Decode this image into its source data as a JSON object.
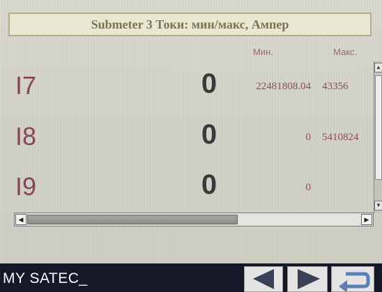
{
  "header": {
    "title": "Submeter 3 Токи: мин/макс, Ампер"
  },
  "columns": {
    "min_label": "Мин.",
    "max_label": "Макс."
  },
  "rows": [
    {
      "label": "I7",
      "value": "0",
      "min": "22481808.04",
      "max": "43356"
    },
    {
      "label": "I8",
      "value": "0",
      "min": "0",
      "max": "5410824"
    },
    {
      "label": "I9",
      "value": "0",
      "min": "0",
      "max": ""
    }
  ],
  "footer": {
    "device_name": "MY SATEC_"
  },
  "icons": {
    "prev": "arrow-left-icon",
    "next": "arrow-right-icon",
    "back": "return-arrow-icon"
  },
  "colors": {
    "title_text": "#7b7650",
    "label_text": "#87455a",
    "value_text": "#3a3a3a",
    "footer_bg": "#151826",
    "nav_arrow": "#3b4257",
    "return_icon": "#5c7fb8"
  }
}
